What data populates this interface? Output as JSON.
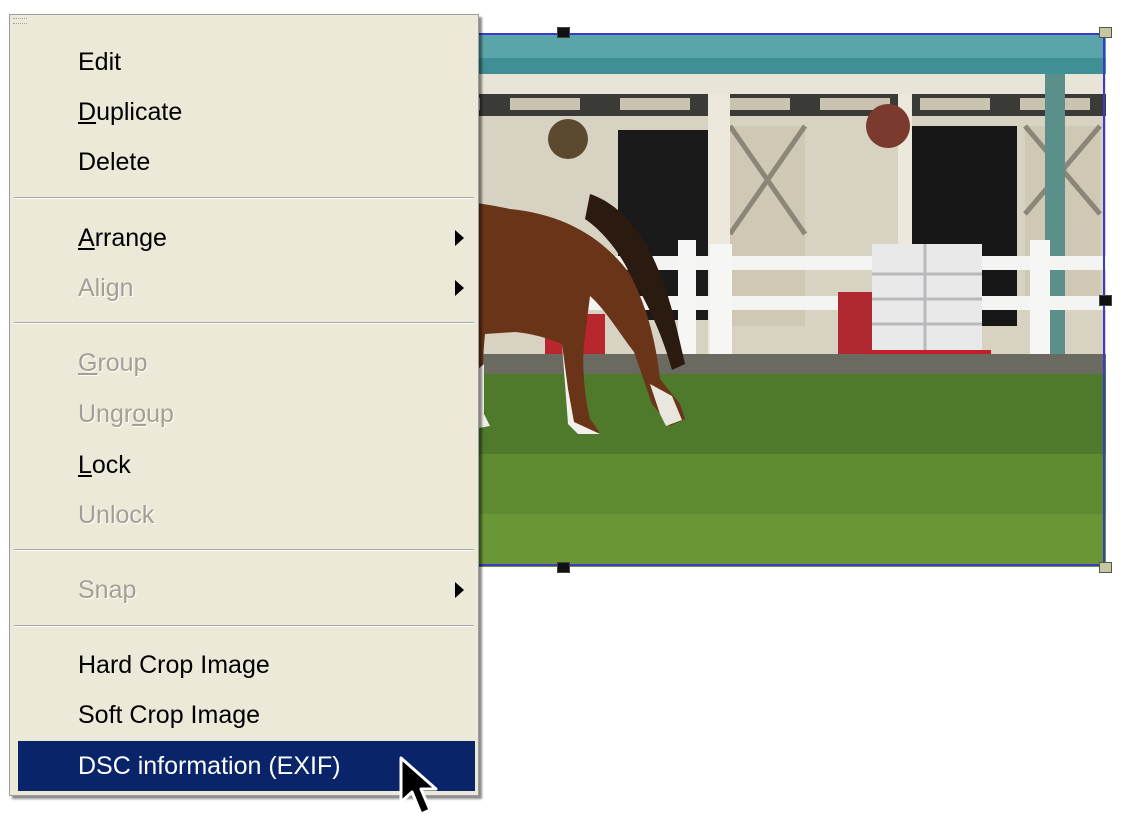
{
  "menu": {
    "items": [
      {
        "label": "Edit",
        "accel": "",
        "disabled": false,
        "submenu": false
      },
      {
        "label": "Duplicate",
        "accel": "D",
        "disabled": false,
        "submenu": false
      },
      {
        "label": "Delete",
        "accel": "",
        "disabled": false,
        "submenu": false
      },
      {
        "label": "Arrange",
        "accel": "A",
        "disabled": false,
        "submenu": true
      },
      {
        "label": "Align",
        "accel": "",
        "disabled": true,
        "submenu": true
      },
      {
        "label": "Group",
        "accel": "G",
        "disabled": true,
        "submenu": false
      },
      {
        "label": "Ungroup",
        "accel": "o",
        "disabled": true,
        "submenu": false
      },
      {
        "label": "Lock",
        "accel": "L",
        "disabled": false,
        "submenu": false
      },
      {
        "label": "Unlock",
        "accel": "",
        "disabled": true,
        "submenu": false
      },
      {
        "label": "Snap",
        "accel": "",
        "disabled": true,
        "submenu": true
      },
      {
        "label": "Hard Crop Image",
        "accel": "",
        "disabled": false,
        "submenu": false
      },
      {
        "label": "Soft Crop Image",
        "accel": "",
        "disabled": false,
        "submenu": false
      },
      {
        "label": "DSC information (EXIF)",
        "accel": "",
        "disabled": false,
        "submenu": false,
        "highlighted": true
      }
    ]
  },
  "colors": {
    "menu_background": "#ece9d8",
    "highlight": "#0a246a",
    "disabled_text": "#a39f93",
    "selection_border": "#3a3acc"
  },
  "cursor": {
    "icon": "arrow-pointer-icon"
  }
}
